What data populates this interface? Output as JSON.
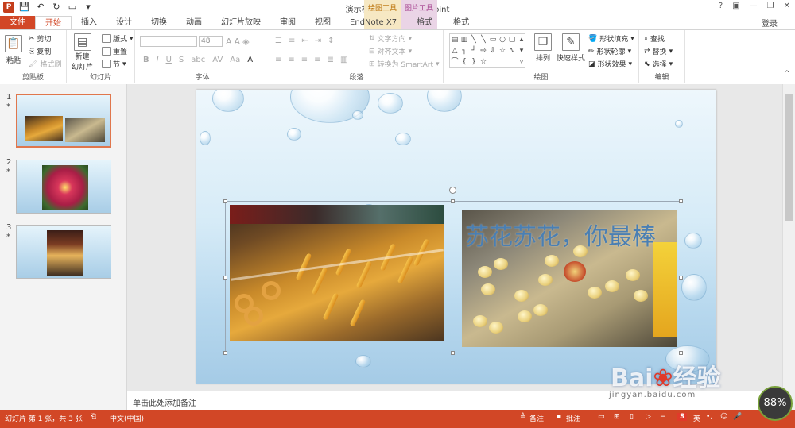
{
  "window": {
    "title": "演示模板.pptx - PowerPoint",
    "help": "?",
    "login": "登录"
  },
  "context_tabs": {
    "drawing_tools": "绘图工具",
    "picture_tools": "图片工具"
  },
  "tabs": [
    "文件",
    "开始",
    "插入",
    "设计",
    "切换",
    "动画",
    "幻灯片放映",
    "审阅",
    "视图",
    "EndNote X7",
    "格式",
    "格式"
  ],
  "ribbon": {
    "clipboard": {
      "paste": "粘贴",
      "cut": "剪切",
      "copy": "复制",
      "format_painter": "格式刷",
      "label": "剪贴板"
    },
    "slides": {
      "new_slide": "新建",
      "new_slide2": "幻灯片",
      "layout": "版式",
      "reset": "重置",
      "section": "节",
      "label": "幻灯片"
    },
    "font": {
      "font_size": "48",
      "label": "字体"
    },
    "paragraph": {
      "text_direction": "文字方向",
      "align_text": "对齐文本",
      "convert_smartart": "转换为 SmartArt",
      "label": "段落"
    },
    "drawing": {
      "arrange": "排列",
      "quick_styles": "快速样式",
      "shape_fill": "形状填充",
      "shape_outline": "形状轮廓",
      "shape_effects": "形状效果",
      "label": "绘图"
    },
    "editing": {
      "find": "查找",
      "replace": "替换",
      "select": "选择",
      "label": "编辑"
    }
  },
  "thumbnails": [
    {
      "number": "1",
      "star": "*"
    },
    {
      "number": "2",
      "star": "*"
    },
    {
      "number": "3",
      "star": "*"
    }
  ],
  "slide": {
    "text": "苏花苏花，你最棒"
  },
  "notes": {
    "placeholder": "单击此处添加备注"
  },
  "status": {
    "slide_info": "幻灯片 第 1 张，共 3 张",
    "language": "中文(中国)",
    "notes_btn": "备注",
    "comments_btn": "批注",
    "ime": "英"
  },
  "zoom": "88%",
  "watermark": {
    "brand": "Bai",
    "brand2": "经验",
    "url": "jingyan.baidu.com"
  }
}
